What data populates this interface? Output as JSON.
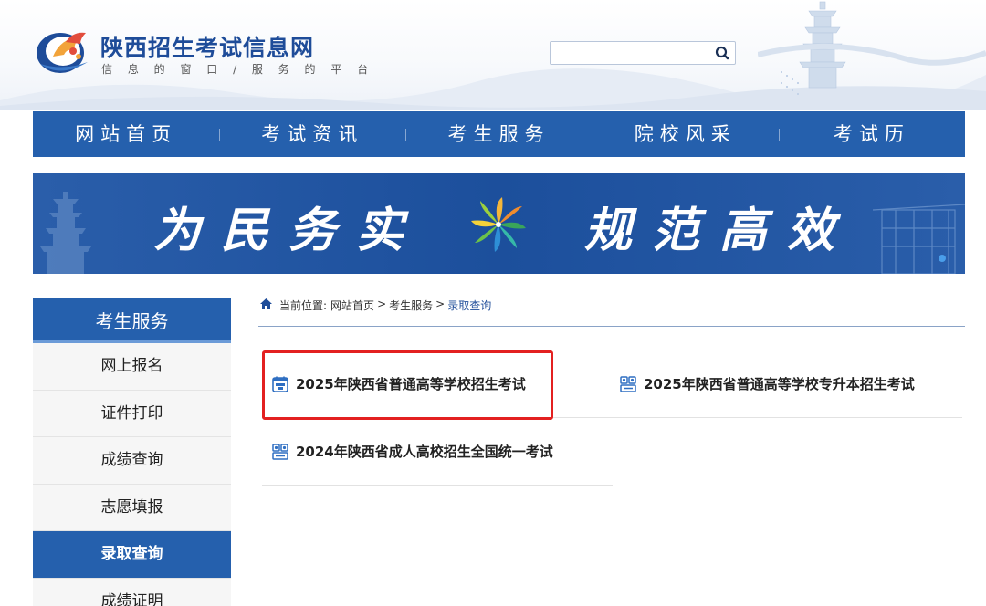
{
  "header": {
    "site_name": "陕西招生考试信息网",
    "slogan": "信 息 的 窗 口 / 服 务 的 平 台",
    "search": {
      "placeholder": "",
      "value": ""
    },
    "search_icon": "search-icon",
    "logo_icon": "bird-flame-logo"
  },
  "nav": {
    "items": [
      {
        "label": "网站首页"
      },
      {
        "label": "考试资讯"
      },
      {
        "label": "考生服务"
      },
      {
        "label": "院校风采"
      },
      {
        "label": "考试历"
      }
    ]
  },
  "banner": {
    "left_text": "为民务实",
    "right_text": "规范高效",
    "emblem": "pinwheel-emblem"
  },
  "sidebar": {
    "title": "考生服务",
    "items": [
      {
        "label": "网上报名",
        "active": false
      },
      {
        "label": "证件打印",
        "active": false
      },
      {
        "label": "成绩查询",
        "active": false
      },
      {
        "label": "志愿填报",
        "active": false
      },
      {
        "label": "录取查询",
        "active": true
      },
      {
        "label": "成绩证明",
        "active": false
      }
    ]
  },
  "breadcrumb": {
    "prefix": "当前位置:",
    "home": "网站首页",
    "separator": ">",
    "section": "考生服务",
    "current": "录取查询"
  },
  "cards": [
    {
      "title": "2025年陕西省普通高等学校招生考试",
      "icon": "exam-calendar-icon",
      "highlighted": true
    },
    {
      "title": "2025年陕西省普通高等学校专升本招生考试",
      "icon": "students-icon",
      "highlighted": false
    },
    {
      "title": "2024年陕西省成人高校招生全国统一考试",
      "icon": "students-icon",
      "highlighted": false
    }
  ],
  "colors": {
    "primary": "#2560ad",
    "highlight": "#e32020",
    "breadcrumb_current": "#1e4c99"
  }
}
